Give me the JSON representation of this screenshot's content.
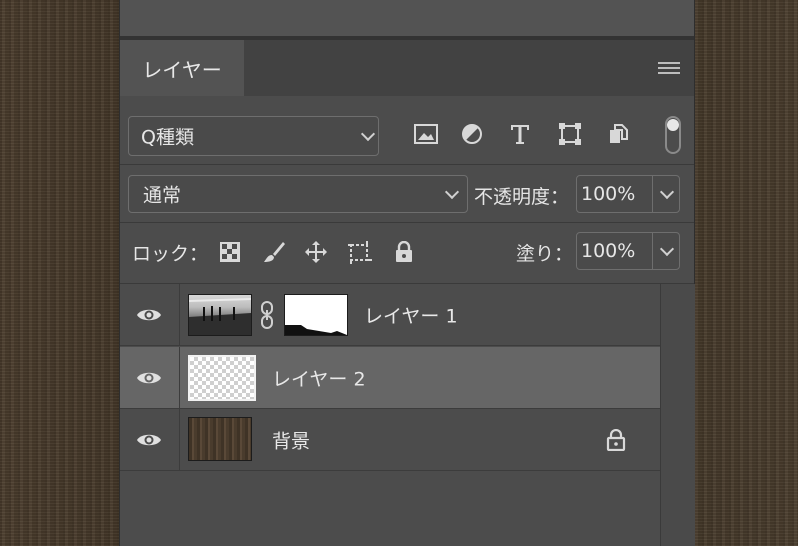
{
  "panel": {
    "tab_label": "レイヤー",
    "menu_icon": "panel-menu-icon"
  },
  "filter": {
    "label": "Q種類",
    "icons": [
      "image-filter-icon",
      "adjustment-filter-icon",
      "type-filter-icon",
      "shape-filter-icon",
      "smart-object-filter-icon"
    ]
  },
  "blend": {
    "mode": "通常",
    "opacity_label": "不透明度：",
    "opacity_value": "100%"
  },
  "lock": {
    "label": "ロック：",
    "icons": [
      "lock-transparent-pixels-icon",
      "lock-image-pixels-icon",
      "lock-position-icon",
      "lock-artboard-icon",
      "lock-all-icon"
    ],
    "fill_label": "塗り：",
    "fill_value": "100%"
  },
  "layers": [
    {
      "name": "レイヤー 1",
      "visible": true,
      "selected": false,
      "has_mask": true,
      "locked": false
    },
    {
      "name": "レイヤー 2",
      "visible": true,
      "selected": true,
      "has_mask": false,
      "locked": false
    },
    {
      "name": "背景",
      "visible": true,
      "selected": false,
      "has_mask": false,
      "locked": true
    }
  ]
}
